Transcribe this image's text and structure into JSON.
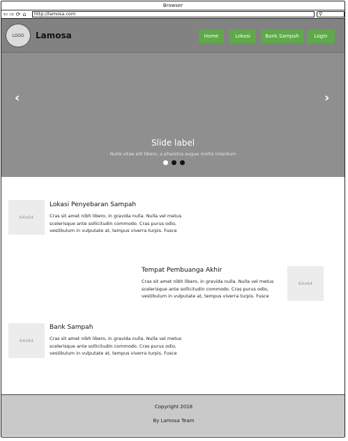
{
  "browser": {
    "title": "Browser",
    "url": "http://lamosa.com",
    "nav_icons": [
      "back-icon",
      "forward-icon",
      "refresh-icon",
      "home-icon"
    ]
  },
  "header": {
    "logo_text": "LOGO",
    "brand": "Lamosa",
    "nav": [
      {
        "label": "Home"
      },
      {
        "label": "Lokasi"
      },
      {
        "label": "Bank Sampah"
      },
      {
        "label": "Login"
      }
    ],
    "accent_color": "#5ea94a"
  },
  "carousel": {
    "prev_icon": "chevron-left-icon",
    "next_icon": "chevron-right-icon",
    "slide_label": "Slide label",
    "caption": "Nulla vitae elit libero, a pharetra augue mollis interdum",
    "indicators": 3,
    "active_index": 0
  },
  "media": [
    {
      "thumb": "64x64",
      "title": "Lokasi Penyebaran Sampah",
      "text": "Cras sit amet nibh libero, in gravida nulla. Nulla vel metus scelerisque ante sollicitudin commodo. Cras purus odio, vestibulum in vulputate at, tempus viverra turpis. Fusce"
    },
    {
      "thumb": "64x64",
      "title": "Tempat Pembuanga Akhir",
      "text": "Cras sit amet nibh libero, in gravida nulla. Nulla vel metus scelerisque ante sollicitudin commodo. Cras purus odio, vestibulum in vulputate at, tempus viverra turpis. Fusce"
    },
    {
      "thumb": "64x64",
      "title": "Bank Sampah",
      "text": "Cras sit amet nibh libero, in gravida nulla. Nulla vel metus scelerisque ante sollicitudin commodo. Cras purus odio, vestibulum in vulputate at, tempus viverra turpis. Fusce"
    }
  ],
  "footer": {
    "copyright": "Copyright 2018",
    "credit": "By Lamosa Team"
  }
}
